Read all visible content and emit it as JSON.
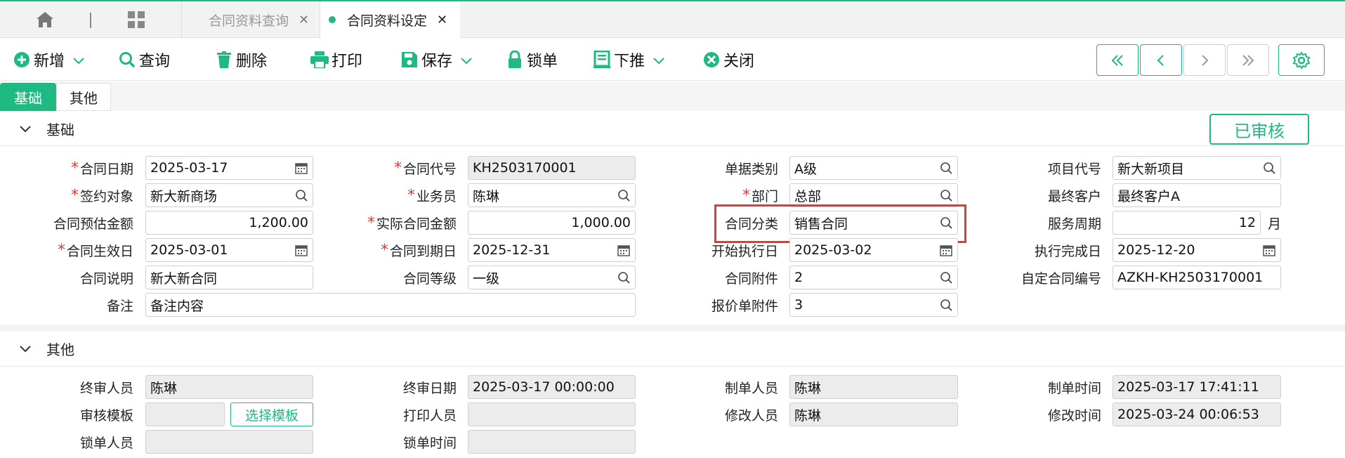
{
  "tabs": [
    {
      "label": "合同资料查询",
      "active": false
    },
    {
      "label": "合同资料设定",
      "active": true
    }
  ],
  "toolbar": {
    "add": "新增",
    "query": "查询",
    "delete": "删除",
    "print": "打印",
    "save": "保存",
    "lock": "锁单",
    "push": "下推",
    "close": "关闭"
  },
  "subtabs": [
    "基础",
    "其他"
  ],
  "sections": {
    "basic": "基础",
    "other": "其他"
  },
  "status": "已审核",
  "basic": {
    "contract_date": {
      "label": "合同日期",
      "value": "2025-03-17"
    },
    "contract_code": {
      "label": "合同代号",
      "value": "KH2503170001"
    },
    "doc_type": {
      "label": "单据类别",
      "value": "A级"
    },
    "project_code": {
      "label": "项目代号",
      "value": "新大新项目"
    },
    "sign_party": {
      "label": "签约对象",
      "value": "新大新商场"
    },
    "salesman": {
      "label": "业务员",
      "value": "陈琳"
    },
    "department": {
      "label": "部门",
      "value": "总部"
    },
    "final_customer": {
      "label": "最终客户",
      "value": "最终客户A"
    },
    "est_amount": {
      "label": "合同预估金额",
      "value": "1,200.00"
    },
    "actual_amount": {
      "label": "实际合同金额",
      "value": "1,000.00"
    },
    "category": {
      "label": "合同分类",
      "value": "销售合同"
    },
    "service_period": {
      "label": "服务周期",
      "value": "12",
      "unit": "月"
    },
    "effective_date": {
      "label": "合同生效日",
      "value": "2025-03-01"
    },
    "expire_date": {
      "label": "合同到期日",
      "value": "2025-12-31"
    },
    "start_date": {
      "label": "开始执行日",
      "value": "2025-03-02"
    },
    "finish_date": {
      "label": "执行完成日",
      "value": "2025-12-20"
    },
    "description": {
      "label": "合同说明",
      "value": "新大新合同"
    },
    "level": {
      "label": "合同等级",
      "value": "一级"
    },
    "attachment": {
      "label": "合同附件",
      "value": "2"
    },
    "custom_code": {
      "label": "自定合同编号",
      "value": "AZKH-KH2503170001"
    },
    "remark": {
      "label": "备注",
      "value": "备注内容"
    },
    "quote_attachment": {
      "label": "报价单附件",
      "value": "3"
    }
  },
  "other": {
    "final_reviewer": {
      "label": "终审人员",
      "value": "陈琳"
    },
    "final_review_date": {
      "label": "终审日期",
      "value": "2025-03-17 00:00:00"
    },
    "creator": {
      "label": "制单人员",
      "value": "陈琳"
    },
    "create_time": {
      "label": "制单时间",
      "value": "2025-03-17 17:41:11"
    },
    "review_template": {
      "label": "审核模板",
      "value": "",
      "button": "选择模板"
    },
    "printer": {
      "label": "打印人员",
      "value": ""
    },
    "modifier": {
      "label": "修改人员",
      "value": "陈琳"
    },
    "modify_time": {
      "label": "修改时间",
      "value": "2025-03-24 00:06:53"
    },
    "locker": {
      "label": "锁单人员",
      "value": ""
    },
    "lock_time": {
      "label": "锁单时间",
      "value": ""
    }
  },
  "colors": {
    "accent": "#1fb982",
    "required": "#e23b3b",
    "highlight": "#e53935"
  }
}
